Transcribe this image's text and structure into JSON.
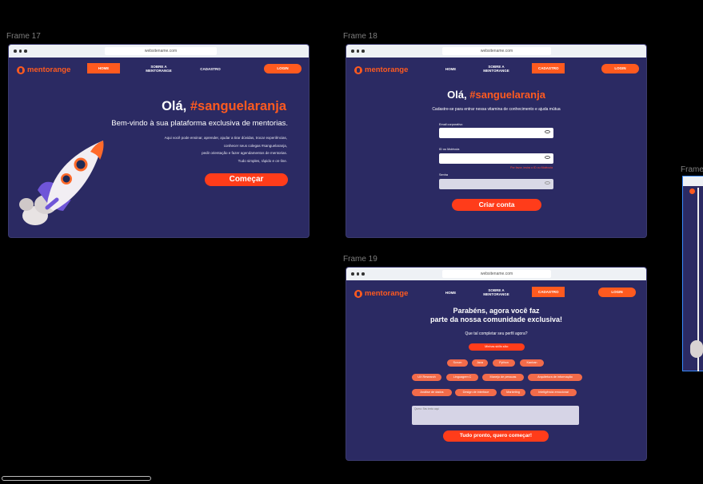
{
  "frames": {
    "f17_label": "Frame 17",
    "f18_label": "Frame 18",
    "f19_label": "Frame 19",
    "f20_label": "Frame"
  },
  "browser": {
    "url": "websitename.com"
  },
  "nav": {
    "brand": "mentorange",
    "home": "HOME",
    "about_line1": "SOBRE A",
    "about_line2": "MENTORANGE",
    "signup": "CADASTRO",
    "login": "LOGIN"
  },
  "hero": {
    "greeting": "Olá,",
    "hashtag": "#sanguelaranja",
    "subtitle": "Bem-vindo à sua plataforma exclusiva de mentorias.",
    "body_lines": [
      "Aqui você pode ensinar, aprender, ajudar a tirar dúvidas, trocar experiências,",
      "conhecer seus colegas #sanguelaranja,",
      "pedir orientação e fazer agendamentos de mentorias.",
      "Tudo simples, rápido e on-line."
    ],
    "cta": "Começar"
  },
  "signup": {
    "greeting": "Olá,",
    "hashtag": "#sanguelaranja",
    "subtitle": "Cadastre-se para entrar nessa vitamina de conhecimento e ajuda mútua",
    "email_label": "Email corporativo",
    "id_label": "ID ou Molécula",
    "id_error": "Por favor, insira o ID ou Molécula",
    "password_label": "Senha",
    "cta": "Criar conta"
  },
  "welcome": {
    "title_line1": "Parabéns, agora você faz",
    "title_line2": "parte da nossa comunidade exclusiva!",
    "question": "Que tal completar seu perfil agora?",
    "skills_button": "Minhas skills são:",
    "skills_row1": [
      "Scrum",
      "Java",
      "Python",
      "Kanban"
    ],
    "skills_row2": [
      "UX Research",
      "Linguagem C",
      "Manejo de pessoas",
      "Arquitetura de informação"
    ],
    "skills_row3": [
      "Análise de dados",
      "Design de interface",
      "Marketing",
      "Inteligência emocional"
    ],
    "textarea_placeholder": "Quero: Seu texto aqui",
    "cta": "Tudo pronto, quero começar!"
  },
  "colors": {
    "background": "#000000",
    "frame_bg": "#2b2a63",
    "accent": "#ff5a1f",
    "cta": "#ff3c1a",
    "pill": "#f26b4a"
  }
}
